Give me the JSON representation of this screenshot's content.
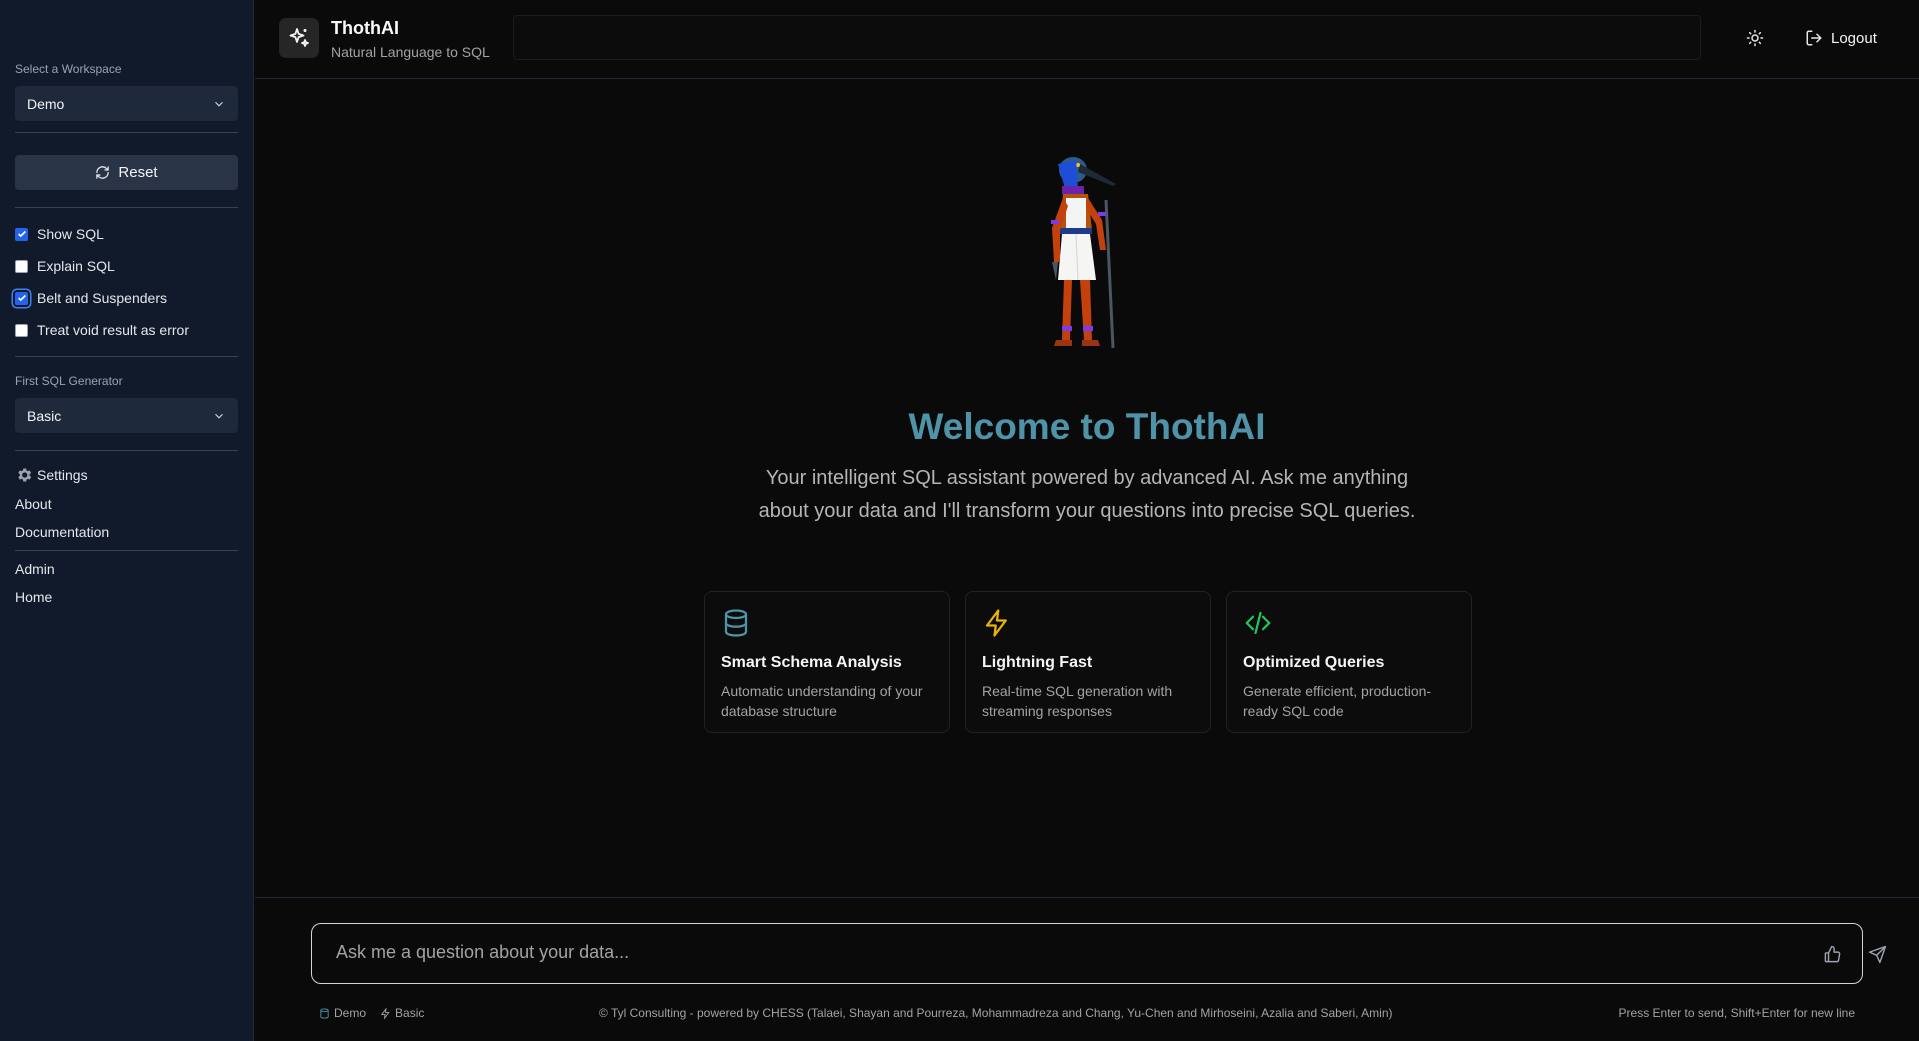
{
  "sidebar": {
    "workspace_label": "Select a Workspace",
    "workspace_value": "Demo",
    "reset_label": "Reset",
    "checks": [
      {
        "label": "Show SQL",
        "checked": true
      },
      {
        "label": "Explain SQL",
        "checked": false
      },
      {
        "label": "Belt and Suspenders",
        "checked": true
      },
      {
        "label": "Treat void result as error",
        "checked": false
      }
    ],
    "generator_label": "First SQL Generator",
    "generator_value": "Basic",
    "settings": "Settings",
    "about": "About",
    "documentation": "Documentation",
    "admin": "Admin",
    "home": "Home"
  },
  "header": {
    "title": "ThothAI",
    "subtitle": "Natural Language to SQL",
    "logout": "Logout"
  },
  "main": {
    "welcome": "Welcome to ThothAI",
    "tagline": "Your intelligent SQL assistant powered by advanced AI. Ask me anything about your data and I'll transform your questions into precise SQL queries.",
    "cards": [
      {
        "icon": "database-icon",
        "title": "Smart Schema Analysis",
        "desc": "Automatic understanding of your database structure"
      },
      {
        "icon": "lightning-icon",
        "title": "Lightning Fast",
        "desc": "Real-time SQL generation with streaming responses"
      },
      {
        "icon": "code-icon",
        "title": "Optimized Queries",
        "desc": "Generate efficient, production-ready SQL code"
      }
    ]
  },
  "chat": {
    "placeholder": "Ask me a question about your data..."
  },
  "footer": {
    "workspace": "Demo",
    "generator": "Basic",
    "credits": "© Tyl Consulting - powered by CHESS (Talaei, Shayan and Pourreza, Mohammadreza and Chang, Yu-Chen and Mirhoseini, Azalia and Saberi, Amin)",
    "hint": "Press Enter to send, Shift+Enter for new line"
  },
  "colors": {
    "accent": "#4f93a8",
    "checkbox": "#2563eb",
    "database_icon": "#4f93a8",
    "lightning_icon": "#eab308",
    "code_icon": "#22c55e"
  }
}
